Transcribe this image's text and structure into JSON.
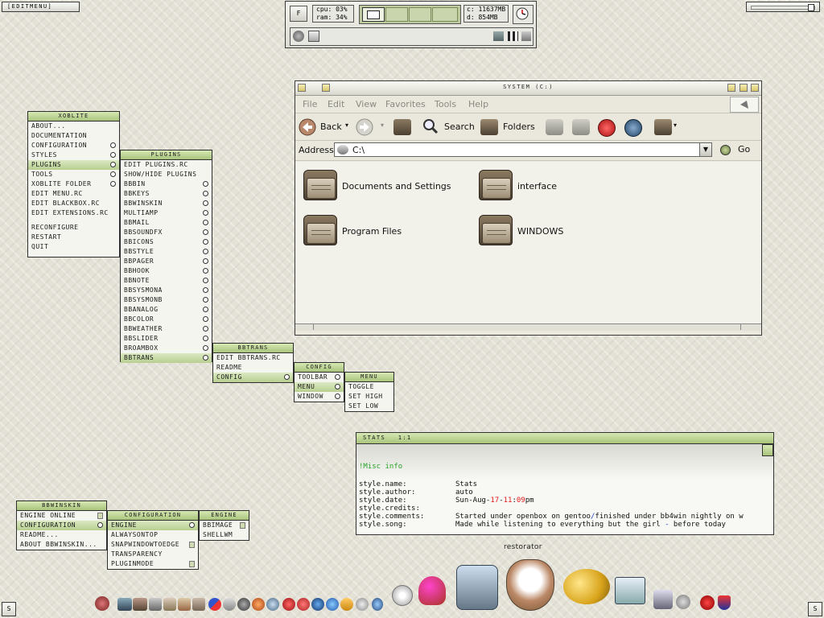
{
  "editmenu_label": "[EDITMENU]",
  "sysmon": {
    "f_button": "F",
    "cpu_label": "cpu: 03%",
    "ram_label": "ram: 34%",
    "disk_c": "c: 11637MB",
    "disk_d": "d: 854MB"
  },
  "xoblite_menu": {
    "title": "XOBLITE",
    "items": [
      "ABOUT...",
      "DOCUMENTATION",
      "CONFIGURATION",
      "STYLES",
      "PLUGINS",
      "TOOLS",
      "XOBLITE FOLDER",
      "EDIT MENU.RC",
      "EDIT BLACKBOX.RC",
      "EDIT EXTENSIONS.RC",
      "RECONFIGURE",
      "RESTART",
      "QUIT"
    ]
  },
  "plugins_menu": {
    "title": "PLUGINS",
    "items": [
      "EDIT PLUGINS.RC",
      "SHOW/HIDE PLUGINS",
      "BBBIN",
      "BBKEYS",
      "BBWINSKIN",
      "MULTIAMP",
      "BBMAIL",
      "BBSOUNDFX",
      "BBICONS",
      "BBSTYLE",
      "BBPAGER",
      "BBHOOK",
      "BBNOTE",
      "BBSYSMONA",
      "BBSYSMONB",
      "BBANALOG",
      "BBCOLOR",
      "BBWEATHER",
      "BBSLIDER",
      "BROAMBOX",
      "BBTRANS"
    ]
  },
  "bbtrans_menu": {
    "title": "BBTRANS",
    "items": [
      "EDIT BBTRANS.RC",
      "README",
      "CONFIG"
    ]
  },
  "config_menu": {
    "title": "CONFIG",
    "items": [
      "TOOLBAR",
      "MENU",
      "WINDOW"
    ]
  },
  "menu_menu": {
    "title": "MENU",
    "items": [
      "TOGGLE",
      "SET HIGH",
      "SET LOW"
    ]
  },
  "bbwinskin_menu": {
    "title": "BBWINSKIN",
    "items": [
      "ENGINE ONLINE",
      "CONFIGURATION",
      "README...",
      "ABOUT BBWINSKIN..."
    ]
  },
  "configuration_menu": {
    "title": "CONFIGURATION",
    "items": [
      "ENGINE",
      "ALWAYSONTOP",
      "SNAPWINDOWTOEDGE",
      "TRANSPARENCY",
      "PLUGINMODE"
    ]
  },
  "engine_menu": {
    "title": "ENGINE",
    "items": [
      "BBIMAGE",
      "SHELLWM"
    ]
  },
  "explorer": {
    "title": "SYSTEM (C:)",
    "menu": [
      "File",
      "Edit",
      "View",
      "Favorites",
      "Tools",
      "Help"
    ],
    "toolbar": {
      "back": "Back",
      "search": "Search",
      "folders": "Folders"
    },
    "address_label": "Address",
    "address_value": "C:\\",
    "go_label": "Go",
    "folders": [
      "Documents and Settings",
      "interface",
      "Program Files",
      "WINDOWS"
    ]
  },
  "stats": {
    "title": "STATS",
    "title_right": "1:1",
    "heading": "!Misc info",
    "rows": [
      {
        "key": "style.name:",
        "value": "Stats"
      },
      {
        "key": "style.author:",
        "value": "auto"
      },
      {
        "key": "style.date:",
        "value": "Sun-Aug-17-11:09pm"
      },
      {
        "key": "style.credits:",
        "value": ""
      },
      {
        "key": "style.comments:",
        "value": "Started under openbox on gentoo/finished under bb4win nightly on w"
      },
      {
        "key": "style.song:",
        "value": "Made while listening to everything but the girl - before today"
      }
    ]
  },
  "dock": {
    "tooltip": "restorator"
  },
  "corner_left": "S",
  "corner_right": "S",
  "colors": {
    "accent_green": "#a9c47c",
    "highlight_red": "#e41b1b",
    "stats_green": "#2aa32a",
    "stats_blue": "#2b3fd1"
  }
}
